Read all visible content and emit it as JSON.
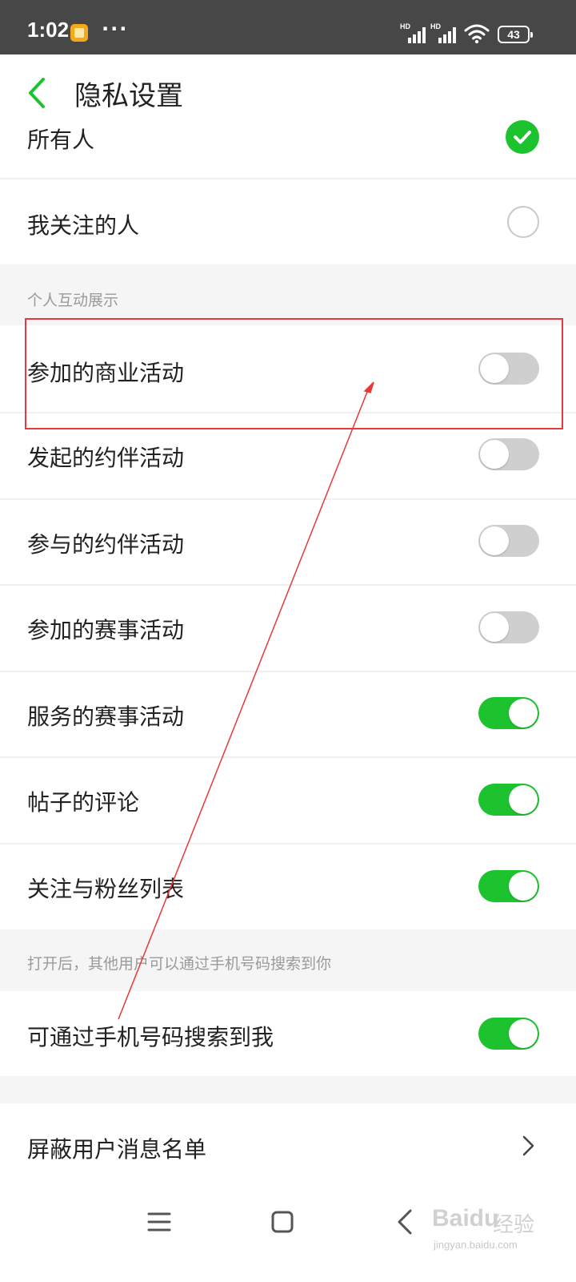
{
  "status_bar": {
    "time": "1:02",
    "dots": "···",
    "signal_labels": [
      "HD",
      "HD"
    ],
    "battery": "43",
    "icons": [
      "notification-icon",
      "signal-icon",
      "wifi-icon",
      "battery-icon"
    ]
  },
  "header": {
    "title": "隐私设置",
    "back_icon": "chevron-left-icon"
  },
  "visibility_options": [
    {
      "label": "所有人",
      "selected": true
    },
    {
      "label": "我关注的人",
      "selected": false
    }
  ],
  "section_interaction": {
    "title": "个人互动展示",
    "items": [
      {
        "label": "参加的商业活动",
        "on": false
      },
      {
        "label": "发起的约伴活动",
        "on": false
      },
      {
        "label": "参与的约伴活动",
        "on": false
      },
      {
        "label": "参加的赛事活动",
        "on": false
      },
      {
        "label": "服务的赛事活动",
        "on": true
      },
      {
        "label": "帖子的评论",
        "on": true
      },
      {
        "label": "关注与粉丝列表",
        "on": true
      }
    ]
  },
  "section_phone": {
    "note": "打开后，其他用户可以通过手机号码搜索到你",
    "item": {
      "label": "可通过手机号码搜索到我",
      "on": true
    }
  },
  "blocked_list": {
    "label": "屏蔽用户消息名单",
    "icon": "chevron-right-icon"
  },
  "nav_bar": {
    "icons": [
      "menu-icon",
      "home-icon",
      "back-icon"
    ]
  },
  "watermark": {
    "main": "Baidu",
    "cn": "经验",
    "url": "jingyan.baidu.com"
  },
  "colors": {
    "accent": "#1dc32f",
    "status_bar": "#474747",
    "toggle_off": "#cfcfcf",
    "annotation": "#e8383a",
    "background_gray": "#f5f5f5"
  }
}
